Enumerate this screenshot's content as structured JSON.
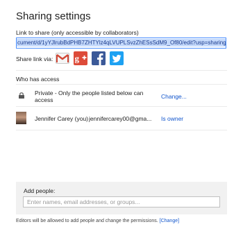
{
  "dialog": {
    "title": "Sharing settings"
  },
  "link": {
    "label": "Link to share (only accessible by collaborators)",
    "value": "cument/d/1yYJlrubBdPHB7ZHTYlz4qLVUPLSvzZhESsSdM9_Of80/edit?usp=sharing"
  },
  "share_via": {
    "label": "Share link via:",
    "services": [
      "gmail-icon",
      "google-plus-icon",
      "facebook-icon",
      "twitter-icon"
    ],
    "colors": {
      "gmail": "#d14836",
      "google_plus": "#dd4b39",
      "facebook": "#3b5998",
      "twitter": "#1da1f2"
    }
  },
  "access": {
    "label": "Who has access",
    "private_text": "Private - Only the people listed below can access",
    "change_link": "Change...",
    "users": [
      {
        "name": "Jennifer Carey (you)",
        "email": "jennifercarey00@gma...",
        "role": "Is owner"
      }
    ]
  },
  "add_people": {
    "label": "Add people:",
    "placeholder": "Enter names, email addresses, or groups..."
  },
  "footer": {
    "text": "Editors will be allowed to add people and change the permissions.",
    "link": "[Change]"
  },
  "colors": {
    "link_blue": "#1155cc",
    "selection": "#c5dafc",
    "focus_border": "#4d90fe"
  }
}
